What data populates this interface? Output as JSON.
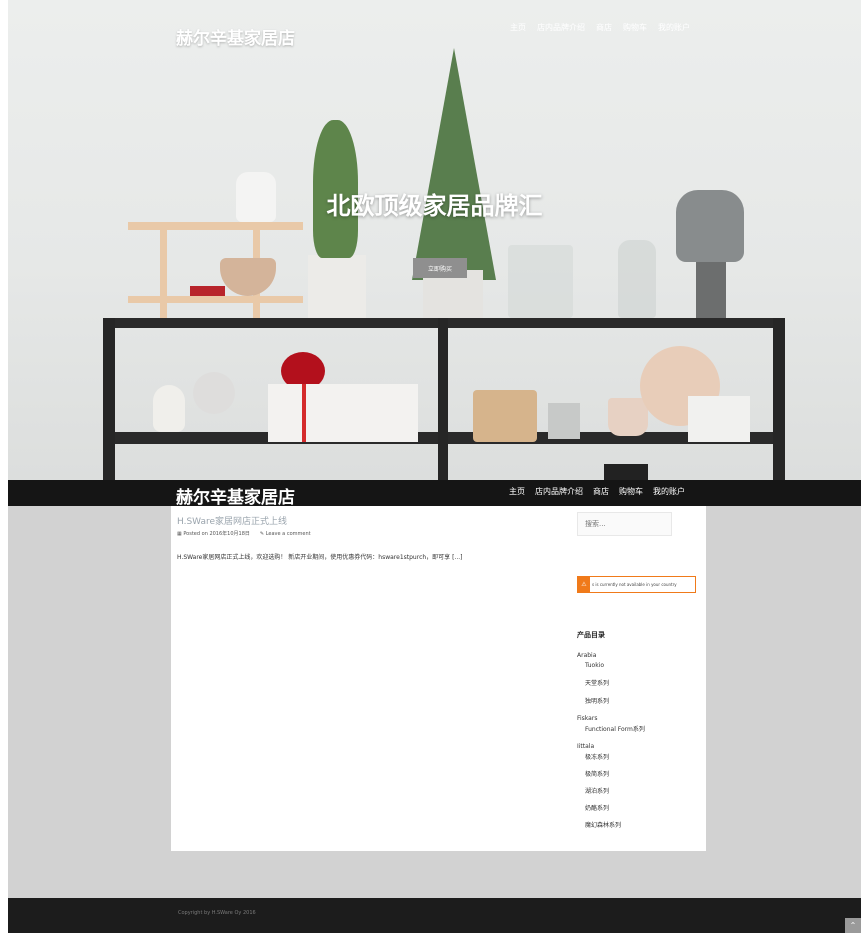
{
  "site": {
    "name": "赫尔辛基家居店"
  },
  "nav": {
    "items": [
      "主页",
      "店内品牌介绍",
      "商店",
      "购物车",
      "我的账户"
    ]
  },
  "hero": {
    "title": "北欧顶级家居品牌汇",
    "button_label": "立即购买"
  },
  "post": {
    "title": "H.SWare家居网店正式上线",
    "posted_on": "Posted on 2016年10月18日",
    "comment_link": "Leave a comment",
    "excerpt": "H.SWare家居网店正式上线，欢迎选购！ 新店开业期间，使用优惠券代码：hsware1stpurch，即可享 [...]"
  },
  "sidebar": {
    "search_placeholder": "搜索...",
    "notice_text": "s is currently not available in your country",
    "categories_title": "产品目录",
    "categories": [
      {
        "label": "Arabia",
        "level": 0
      },
      {
        "label": "Tuokio",
        "level": 1
      },
      {
        "label": "天堂系列",
        "level": 1
      },
      {
        "label": "独明系列",
        "level": 1
      },
      {
        "label": "Fiskars",
        "level": 0
      },
      {
        "label": "Functional Form系列",
        "level": 1
      },
      {
        "label": "Iittala",
        "level": 0
      },
      {
        "label": "极冻系列",
        "level": 1
      },
      {
        "label": "极简系列",
        "level": 1
      },
      {
        "label": "湖泊系列",
        "level": 1
      },
      {
        "label": "奶酪系列",
        "level": 1
      },
      {
        "label": "魔幻森林系列",
        "level": 1
      }
    ]
  },
  "footer": {
    "copyright": "Copyright by H.SWare Oy 2016"
  },
  "colors": {
    "navbar": "#151515",
    "accent_orange": "#f07a1a",
    "content_bg": "#d2d2d2",
    "footer": "#1c1c1c"
  }
}
